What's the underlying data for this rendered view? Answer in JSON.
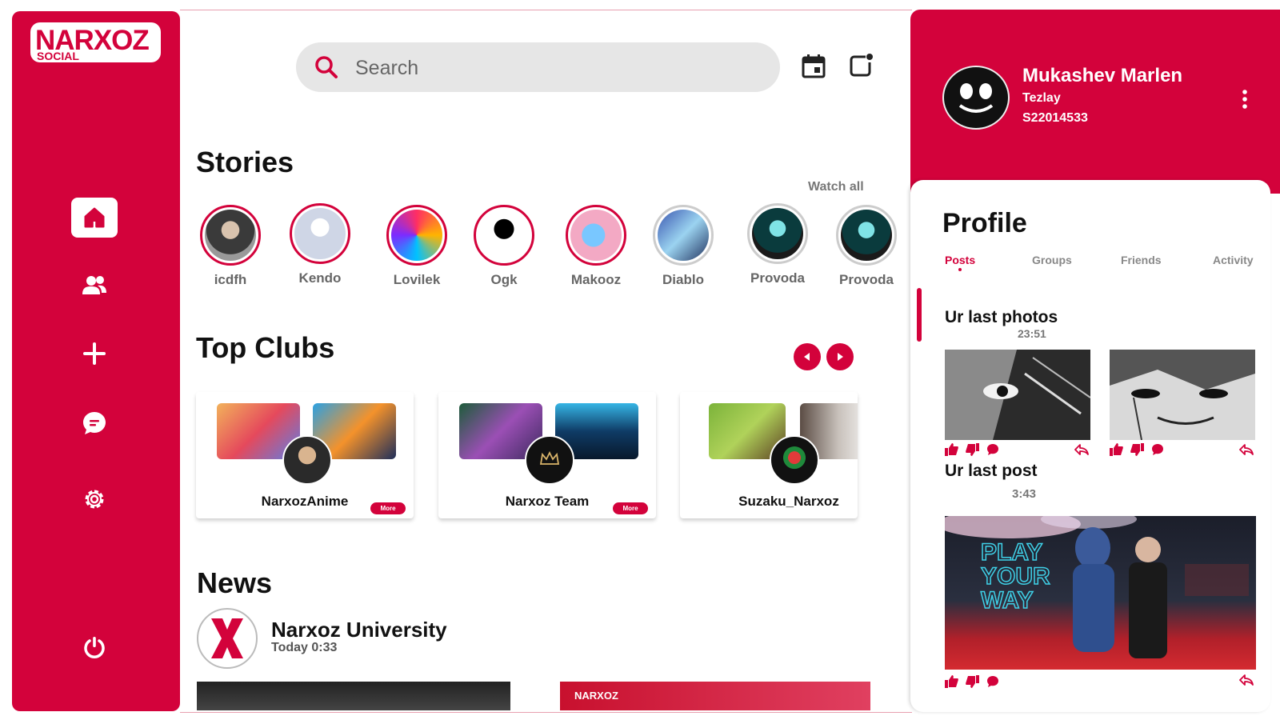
{
  "app": {
    "logo_big": "NARXOZ",
    "logo_small": "SOCIAL"
  },
  "sidebar": {
    "items": [
      {
        "name": "home",
        "icon": "home-icon",
        "active": true
      },
      {
        "name": "friends",
        "icon": "users-icon"
      },
      {
        "name": "create",
        "icon": "plus-icon"
      },
      {
        "name": "messages",
        "icon": "chat-icon"
      },
      {
        "name": "settings",
        "icon": "gear-icon"
      },
      {
        "name": "logout",
        "icon": "power-icon"
      }
    ]
  },
  "header": {
    "search_placeholder": "Search",
    "calendar_icon": "calendar-icon",
    "notes_icon": "notification-icon"
  },
  "stories": {
    "title": "Stories",
    "watch_all": "Watch all",
    "items": [
      {
        "name": "icdfh"
      },
      {
        "name": "Kendo"
      },
      {
        "name": "Lovilek"
      },
      {
        "name": "Ogk"
      },
      {
        "name": "Makooz"
      },
      {
        "name": "Diablo"
      },
      {
        "name": "Provoda"
      },
      {
        "name": "Provoda"
      }
    ]
  },
  "clubs": {
    "title": "Top Clubs",
    "more_label": "More",
    "items": [
      {
        "name": "NarxozAnime"
      },
      {
        "name": "Narxoz Team"
      },
      {
        "name": "Suzaku_Narxoz"
      }
    ]
  },
  "news": {
    "title": "News",
    "author": "Narxoz University",
    "time": "Today 0:33",
    "banner_text": "NARXOZ"
  },
  "profile_header": {
    "name": "Mukashev Marlen",
    "subtitle": "Tezlay",
    "id": "S22014533"
  },
  "profile": {
    "title": "Profile",
    "tabs": [
      "Posts",
      "Groups",
      "Friends",
      "Activity"
    ],
    "active_tab": "Posts",
    "photos_title": "Ur last photos",
    "photos_time": "23:51",
    "post_title": "Ur last post",
    "post_time": "3:43",
    "post_image_text": "PLAY YOUR WAY"
  },
  "colors": {
    "accent": "#d3023b",
    "search_bg": "#e6e6e6"
  }
}
